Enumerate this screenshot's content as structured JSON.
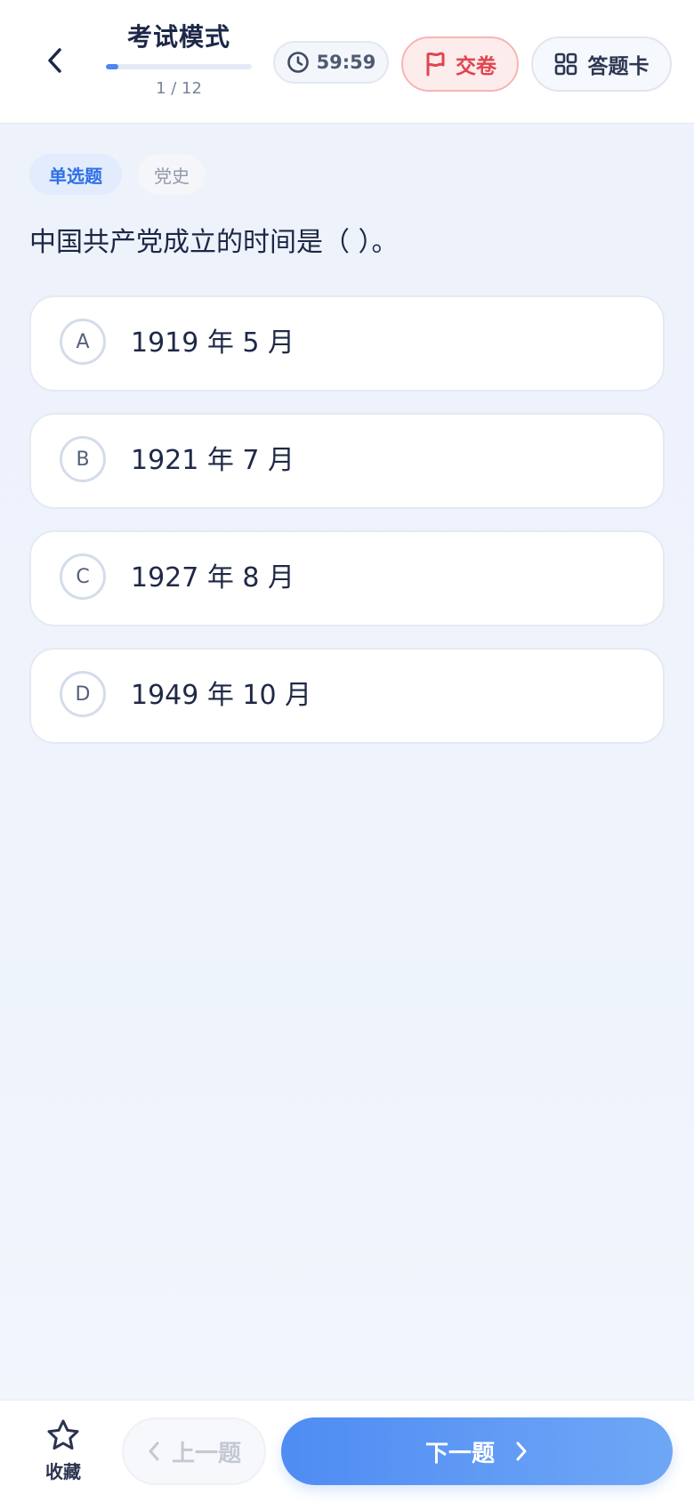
{
  "header": {
    "title": "考试模式",
    "counter": "1 / 12",
    "progress_fraction": 0.083,
    "timer": "59:59",
    "submit_label": "交卷",
    "answer_card_label": "答题卡"
  },
  "question": {
    "type_tag": "单选题",
    "topic_tag": "党史",
    "text": "中国共产党成立的时间是（ ）。",
    "options": [
      {
        "letter": "A",
        "text": "1919 年 5 月"
      },
      {
        "letter": "B",
        "text": "1921 年 7 月"
      },
      {
        "letter": "C",
        "text": "1927 年 8 月"
      },
      {
        "letter": "D",
        "text": "1949 年 10 月"
      }
    ]
  },
  "footer": {
    "favorite_label": "收藏",
    "prev_label": "上一题",
    "next_label": "下一题"
  },
  "colors": {
    "accent": "#4d86f2",
    "submit_red": "#e0454f",
    "text_dark": "#1d2745"
  },
  "icons": {
    "back": "chevron-left-icon",
    "timer": "clock-icon",
    "submit": "flag-icon",
    "answer_card": "grid-icon",
    "favorite": "star-icon",
    "prev": "chevron-left-icon",
    "next": "chevron-right-icon"
  }
}
